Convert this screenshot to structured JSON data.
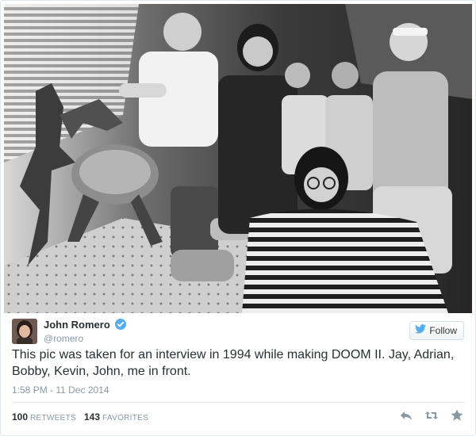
{
  "photo": {
    "alt": "Black and white group photo with monster models"
  },
  "tweet": {
    "author_name": "John Romero",
    "username": "@romero",
    "verified": true,
    "follow_label": "Follow",
    "text": "This pic was taken for an interview in 1994 while making DOOM II. Jay, Adrian, Bobby, Kevin, John, me in front.",
    "timestamp": "1:58 PM - 11 Dec 2014",
    "retweets_count": "100",
    "retweets_label": "RETWEETS",
    "favorites_count": "143",
    "favorites_label": "FAVORITES"
  },
  "colors": {
    "accent": "#55acee",
    "text": "#292f33",
    "muted": "#8899a6",
    "border": "#e1e8ed"
  },
  "icons": [
    "verified-badge-icon",
    "twitter-bird-icon",
    "reply-icon",
    "retweet-icon",
    "favorite-star-icon"
  ]
}
